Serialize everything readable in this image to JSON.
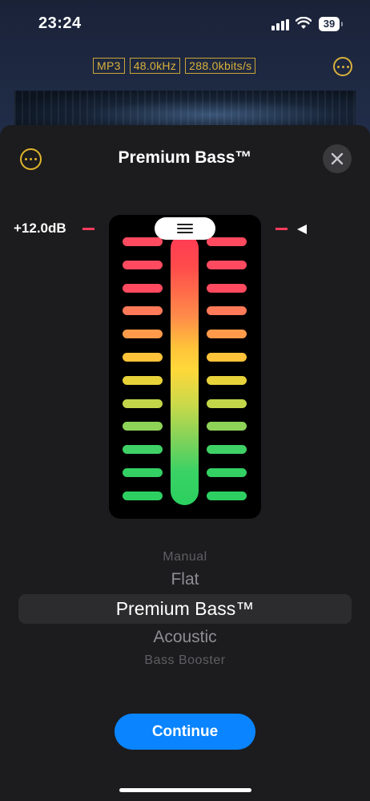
{
  "status": {
    "time": "23:24",
    "battery": "39"
  },
  "player": {
    "format_tags": [
      "MP3",
      "48.0kHz",
      "288.0kbits/s"
    ]
  },
  "sheet": {
    "title": "Premium Bass™",
    "level_readout": "+12.0dB",
    "level_fraction": 1.0
  },
  "meter": {
    "bar_colors": [
      "#ff4a5f",
      "#ff4a5f",
      "#ff4a5f",
      "#ff7a58",
      "#ff9a4a",
      "#ffc33a",
      "#e7d23a",
      "#c3d64a",
      "#8ed357",
      "#3fd166",
      "#33d064",
      "#2ecf62"
    ]
  },
  "presets": {
    "items": [
      "Manual",
      "Flat",
      "Premium Bass™",
      "Acoustic",
      "Bass Booster"
    ],
    "selected": "Premium Bass™"
  },
  "actions": {
    "continue_label": "Continue"
  },
  "colors": {
    "accent": "#0a84ff",
    "gold": "#e2b52b",
    "marker": "#ff3b5c"
  }
}
